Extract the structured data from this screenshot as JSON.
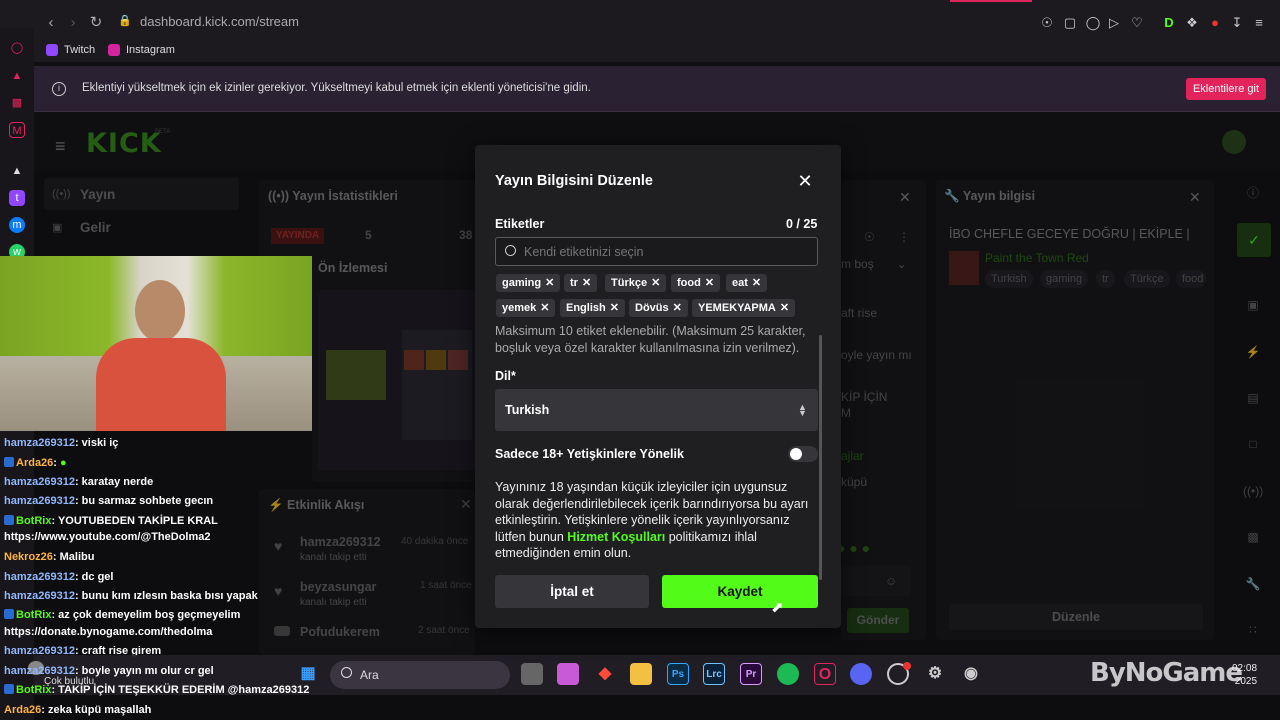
{
  "browser": {
    "url": "dashboard.kick.com/stream",
    "bookmarks": [
      "Twitch",
      "Instagram"
    ]
  },
  "notice": {
    "text": "Eklentiyi yükseltmek için ek izinler gerekiyor. Yükseltmeyi kabul etmek için eklenti yöneticisi'ne gidin.",
    "button": "Eklentilere git"
  },
  "kick": {
    "logo": "KICK",
    "logo_beta": "BETA",
    "nav": [
      "Yayın",
      "Gelir"
    ],
    "stats_title": "Yayın İstatistikleri",
    "live_badge": "YAYINDA",
    "stat1": "5",
    "stat2": "38",
    "preview_title": "Ön İzlemesi",
    "activity_title": "Etkinlik Akışı",
    "activity": [
      {
        "user": "hamza269312",
        "action": "kanalı takip etti",
        "time": "40 dakika önce"
      },
      {
        "user": "beyzasungar",
        "action": "kanalı takip etti",
        "time": "1 saat önce"
      },
      {
        "user": "Pofudukerem",
        "action": "",
        "time": "2 saat önce"
      }
    ],
    "chat_fragments": [
      "aft rise",
      "oyle yayın mı",
      "KİP İÇİN",
      "M",
      "ajlar",
      "küpü",
      "m boş"
    ],
    "send_button": "Gönder",
    "info_title": "Yayın bilgisi",
    "info_stream_title": "İBO CHEFLE GECEYE DOĞRU | EKİPLE |",
    "info_category": "Paint the Town Red",
    "info_tags": [
      "Turkish",
      "gaming",
      "tr",
      "Türkçe",
      "food"
    ],
    "edit_button": "Düzenle"
  },
  "modal": {
    "title": "Yayın Bilgisini Düzenle",
    "tags_label": "Etiketler",
    "tags_count": "0 / 25",
    "tag_placeholder": "Kendi etiketinizi seçin",
    "tags_row1": [
      "gaming",
      "tr",
      "Türkçe",
      "food",
      "eat"
    ],
    "tags_row2": [
      "yemek",
      "English",
      "Dövüs",
      "YEMEKYAPMA"
    ],
    "tags_help": "Maksimum 10 etiket eklenebilir. (Maksimum 25 karakter, boşluk veya özel karakter kullanılmasına izin verilmez).",
    "language_label": "Dil*",
    "language_value": "Turkish",
    "adult_label": "Sadece 18+ Yetişkinlere Yönelik",
    "adult_toggle_on": false,
    "adult_help_pre": "Yayınınız 18 yaşından küçük izleyiciler için uygunsuz olarak değerlendirilebilecek içerik barındırıyorsa bu ayarı etkinleştirin. Yetişkinlere yönelik içerik yayınlıyorsanız lütfen bunun ",
    "adult_help_link": "Hizmet Koşulları",
    "adult_help_post": " politikamızı ihlal etmediğinden emin olun.",
    "cancel": "İptal et",
    "save": "Kaydet"
  },
  "chat": [
    {
      "user": "hamza269312",
      "msg": ": viski iç",
      "kind": "user"
    },
    {
      "user": "Arda26",
      "msg": ": ",
      "kind": "orange",
      "badge": true
    },
    {
      "user": "hamza269312",
      "msg": ": karatay nerde",
      "kind": "user"
    },
    {
      "user": "hamza269312",
      "msg": ": bu sarmaz sohbete gecın",
      "kind": "user"
    },
    {
      "user": "BotRix",
      "msg": ": YOUTUBEDEN TAKİPLE KRAL",
      "kind": "bot",
      "badge": true
    },
    {
      "user": "",
      "msg": "https://www.youtube.com/@TheDolma2",
      "kind": "plain"
    },
    {
      "user": "Nekroz26",
      "msg": ": Malibu",
      "kind": "orange"
    },
    {
      "user": "hamza269312",
      "msg": ": dc gel",
      "kind": "user"
    },
    {
      "user": "hamza269312",
      "msg": ": bunu kım ızlesın baska bısı yapak",
      "kind": "user"
    },
    {
      "user": "BotRix",
      "msg": ": az çok demeyelim boş geçmeyelim",
      "kind": "bot",
      "badge": true
    },
    {
      "user": "",
      "msg": "https://donate.bynogame.com/thedolma",
      "kind": "plain"
    },
    {
      "user": "hamza269312",
      "msg": ": craft rise girem",
      "kind": "user"
    },
    {
      "user": "hamza269312",
      "msg": ": boyle yayın mı olur cr gel",
      "kind": "user"
    },
    {
      "user": "BotRix",
      "msg": ": TAKİP İÇİN TEŞEKKÜR EDERİM @hamza269312",
      "kind": "bot",
      "badge": true
    },
    {
      "user": "Arda26",
      "msg": ": zeka küpü maşallah",
      "kind": "orange"
    }
  ],
  "taskbar": {
    "search": "Ara",
    "weather": "Çok bulutlu",
    "time": "02:08",
    "year": "2025",
    "watermark": "ByNoGame"
  }
}
